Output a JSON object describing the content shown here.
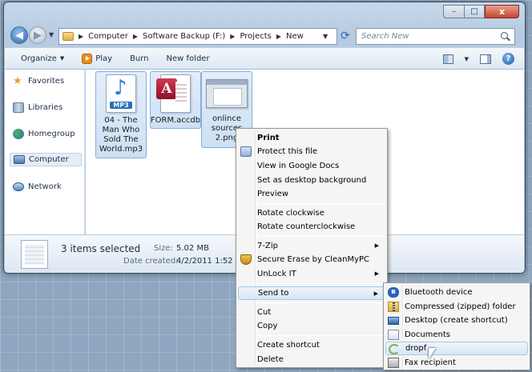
{
  "window": {
    "caption_buttons": {
      "minimize": "–",
      "maximize": "□",
      "close": "x"
    },
    "nav": {
      "back_icon": "back-arrow-icon",
      "forward_icon": "forward-arrow-icon"
    },
    "address": {
      "segments": [
        "Computer",
        "Software Backup (F:)",
        "Projects",
        "New"
      ]
    },
    "search": {
      "placeholder": "Search New"
    },
    "toolbar": {
      "organize": "Organize",
      "play": "Play",
      "burn": "Burn",
      "new_folder": "New folder"
    },
    "sidebar": [
      {
        "label": "Favorites",
        "icon": "star-icon"
      },
      {
        "label": "Libraries",
        "icon": "libraries-icon"
      },
      {
        "label": "Homegroup",
        "icon": "homegroup-icon"
      },
      {
        "label": "Computer",
        "icon": "computer-icon",
        "selected": true
      },
      {
        "label": "Network",
        "icon": "network-icon"
      }
    ],
    "files": [
      {
        "name": "04 - The Man Who Sold The World.mp3",
        "lines": [
          "04 - The",
          "Man Who",
          "Sold The",
          "World.mp3"
        ],
        "type": "mp3",
        "selected": true
      },
      {
        "name": "FORM.accdb",
        "lines": [
          "FORM.accdb"
        ],
        "type": "accdb",
        "selected": true
      },
      {
        "name": "onlince sources 2.png",
        "lines": [
          "onlince",
          "sources",
          "2.png"
        ],
        "type": "png",
        "selected": true
      }
    ],
    "details": {
      "count": "3 items selected",
      "size_label": "Size:",
      "size_value": "5.02 MB",
      "date_label": "Date created:",
      "date_value": "4/2/2011 1:52 AM"
    }
  },
  "context_menu": {
    "items": [
      {
        "label": "Print",
        "bold": true
      },
      {
        "label": "Protect this file",
        "icon": "protect-file-icon"
      },
      {
        "label": "View in Google Docs"
      },
      {
        "label": "Set as desktop background"
      },
      {
        "label": "Preview"
      },
      {
        "label": "Rotate clockwise"
      },
      {
        "label": "Rotate counterclockwise"
      },
      {
        "label": "7-Zip",
        "submenu": true
      },
      {
        "label": "Secure Erase by CleanMyPC",
        "icon": "shield-icon"
      },
      {
        "label": "UnLock IT",
        "submenu": true
      },
      {
        "label": "Send to",
        "submenu": true,
        "highlight": true
      },
      {
        "label": "Cut"
      },
      {
        "label": "Copy"
      },
      {
        "label": "Create shortcut"
      },
      {
        "label": "Delete"
      }
    ]
  },
  "send_to_menu": {
    "items": [
      {
        "label": "Bluetooth device",
        "icon": "bluetooth-icon"
      },
      {
        "label": "Compressed (zipped) folder",
        "icon": "zip-folder-icon"
      },
      {
        "label": "Desktop (create shortcut)",
        "icon": "desktop-icon"
      },
      {
        "label": "Documents",
        "icon": "documents-icon"
      },
      {
        "label": "dropf",
        "icon": "dropf-icon",
        "highlight": true
      },
      {
        "label": "Fax recipient",
        "icon": "fax-icon"
      }
    ]
  },
  "colors": {
    "desktop": "#8ea6bf",
    "selection": "#cde0f5",
    "menu_highlight": "#d9e6f6"
  }
}
